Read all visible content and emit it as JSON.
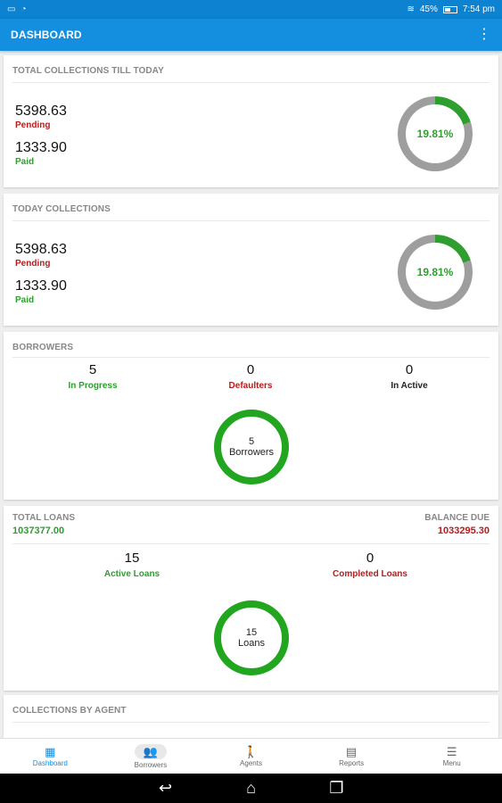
{
  "statusbar": {
    "battery_percent": "45%",
    "time": "7:54 pm",
    "icons": [
      "notification-icon",
      "tray-icon",
      "wifi-icon",
      "battery-icon"
    ]
  },
  "appbar": {
    "title": "DASHBOARD",
    "overflow_icon": "⋮"
  },
  "total_collections": {
    "title": "TOTAL COLLECTIONS TILL TODAY",
    "pending_value": "5398.63",
    "pending_label": "Pending",
    "paid_value": "1333.90",
    "paid_label": "Paid",
    "percent_text": "19.81%",
    "percent_value": 19.81,
    "progress_color": "#2e9e2e",
    "track_color": "#9e9e9e"
  },
  "today_collections": {
    "title": "TODAY COLLECTIONS",
    "pending_value": "5398.63",
    "pending_label": "Pending",
    "paid_value": "1333.90",
    "paid_label": "Paid",
    "percent_text": "19.81%",
    "percent_value": 19.81
  },
  "borrowers": {
    "title": "BORROWERS",
    "stats": [
      {
        "value": "5",
        "label": "In Progress",
        "color": "#2e9e2e"
      },
      {
        "value": "0",
        "label": "Defaulters",
        "color": "#b71c1c"
      },
      {
        "value": "0",
        "label": "In Active",
        "color": "#222222"
      }
    ],
    "ring_value": "5",
    "ring_label": "Borrowers"
  },
  "loans": {
    "total_label": "TOTAL LOANS",
    "total_value": "1037377.00",
    "balance_label": "BALANCE DUE",
    "balance_value": "1033295.30",
    "active_value": "15",
    "active_label": "Active Loans",
    "completed_value": "0",
    "completed_label": "Completed Loans",
    "ring_value": "15",
    "ring_label": "Loans"
  },
  "collections_by_agent": {
    "title": "COLLECTIONS BY AGENT"
  },
  "bottomnav": {
    "items": [
      {
        "label": "Dashboard",
        "icon": "dashboard-icon",
        "active": true
      },
      {
        "label": "Borrowers",
        "icon": "people-icon",
        "active": false
      },
      {
        "label": "Agents",
        "icon": "walker-icon",
        "active": false
      },
      {
        "label": "Reports",
        "icon": "report-icon",
        "active": false
      },
      {
        "label": "Menu",
        "icon": "menu-icon",
        "active": false
      }
    ]
  },
  "colors": {
    "primary": "#148fe0",
    "green": "#2e9e2e",
    "red": "#b71c1c",
    "ring": "#22a51f"
  }
}
